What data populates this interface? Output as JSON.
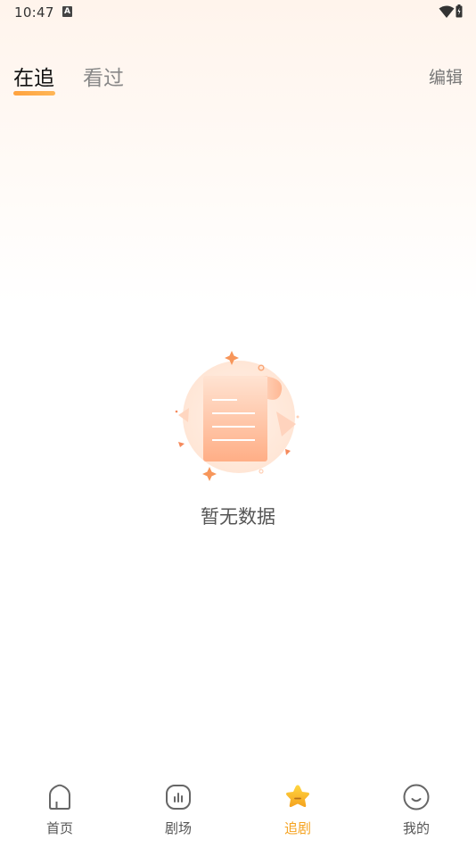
{
  "status_bar": {
    "time": "10:47",
    "notification_icon_letter": "A",
    "icons": [
      "wifi-icon",
      "battery-icon"
    ]
  },
  "top_tabs": {
    "items": [
      {
        "label": "在追",
        "active": true
      },
      {
        "label": "看过",
        "active": false
      }
    ],
    "edit_label": "编辑"
  },
  "empty_state": {
    "icon": "document-scroll-icon",
    "text": "暂无数据"
  },
  "bottom_nav": {
    "items": [
      {
        "label": "首页",
        "icon": "home-icon",
        "active": false
      },
      {
        "label": "剧场",
        "icon": "theater-icon",
        "active": false
      },
      {
        "label": "追剧",
        "icon": "star-icon",
        "active": true
      },
      {
        "label": "我的",
        "icon": "profile-icon",
        "active": false
      }
    ]
  },
  "colors": {
    "accent": "#f5a21f",
    "header_gradient_top": "#fff4ec",
    "text_primary": "#111111",
    "text_secondary": "#888888"
  }
}
